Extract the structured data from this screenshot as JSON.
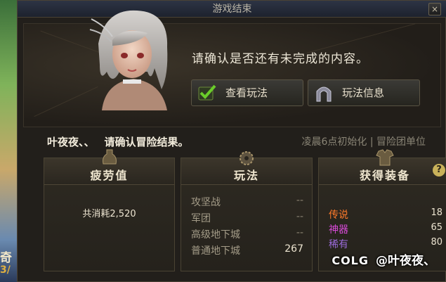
{
  "window": {
    "title": "游戏结束",
    "close_label": "×"
  },
  "dialog": {
    "confirm_text": "请确认是否还有未完成的内容。",
    "btn_view_label": "查看玩法",
    "btn_info_label": "玩法信息",
    "player_name": "叶夜夜、、",
    "player_msg": "请确认冒险结果。",
    "reset_note": "凌晨6点初始化 | 冒险团单位"
  },
  "fatigue": {
    "title": "疲劳值",
    "total": "共消耗2,520"
  },
  "mode": {
    "title": "玩法",
    "rows": [
      {
        "name": "攻坚战",
        "value": "--"
      },
      {
        "name": "军团",
        "value": "--"
      },
      {
        "name": "高级地下城",
        "value": "--"
      },
      {
        "name": "普通地下城",
        "value": "267"
      }
    ]
  },
  "loot": {
    "title": "获得装备",
    "help_label": "?",
    "rows": [
      {
        "name": "传说",
        "value": "18",
        "color": "#ff7a2a"
      },
      {
        "name": "神器",
        "value": "65",
        "color": "#d84ad8"
      },
      {
        "name": "稀有",
        "value": "80",
        "color": "#9a6ad8"
      }
    ]
  },
  "background": {
    "left_text": "奇迹",
    "left_num": "3/"
  },
  "watermark": {
    "logo": "COLG",
    "handle": "@叶夜夜、"
  }
}
